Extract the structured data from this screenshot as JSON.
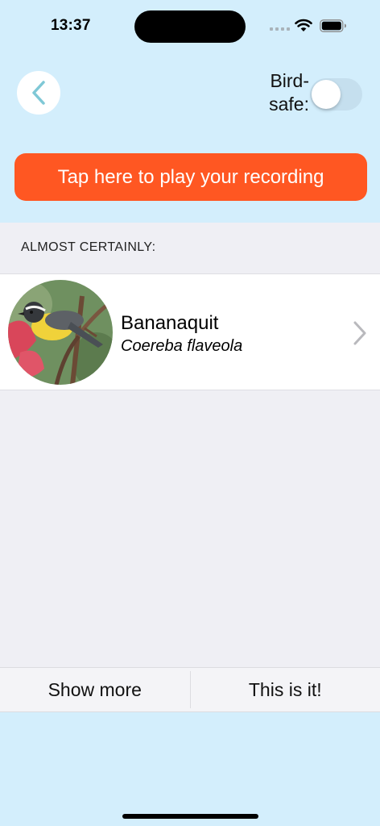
{
  "status_bar": {
    "time": "13:37",
    "icons": [
      "signal-icon",
      "wifi-icon",
      "battery-icon"
    ]
  },
  "header": {
    "back_icon": "chevron-left-icon",
    "birdsafe_label": "Bird-safe:",
    "birdsafe_on": false
  },
  "play_button": {
    "label": "Tap here to play your recording",
    "color": "#ff5722"
  },
  "results": {
    "section_header": "ALMOST CERTAINLY:",
    "items": [
      {
        "common_name": "Bananaquit",
        "scientific_name": "Coereba flaveola",
        "image": "bird-photo-bananaquit",
        "icon": "chevron-right-icon"
      }
    ]
  },
  "bottom_bar": {
    "show_more": "Show more",
    "this_is_it": "This is it!"
  },
  "colors": {
    "background": "#d3eefc",
    "list_background": "#efeff4",
    "accent": "#ff5722"
  }
}
